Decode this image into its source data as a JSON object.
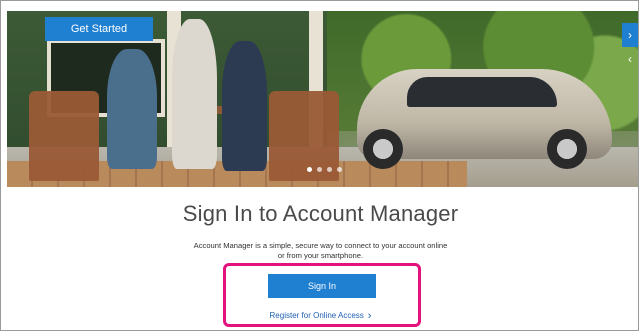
{
  "hero": {
    "get_started_label": "Get Started",
    "next_icon": "chevron-right-icon",
    "prev_icon": "chevron-left-icon",
    "next_glyph": "›",
    "prev_glyph": "‹"
  },
  "main": {
    "title": "Sign In to Account Manager",
    "description_line1": "Account Manager is a simple, secure way to connect to your account online",
    "description_line2": "or from your smartphone.",
    "sign_in_label": "Sign In",
    "register_label": "Register for Online Access",
    "register_chevron": "›"
  },
  "colors": {
    "accent": "#1f7fd1",
    "highlight": "#e3137e",
    "link": "#1f5fb3"
  }
}
